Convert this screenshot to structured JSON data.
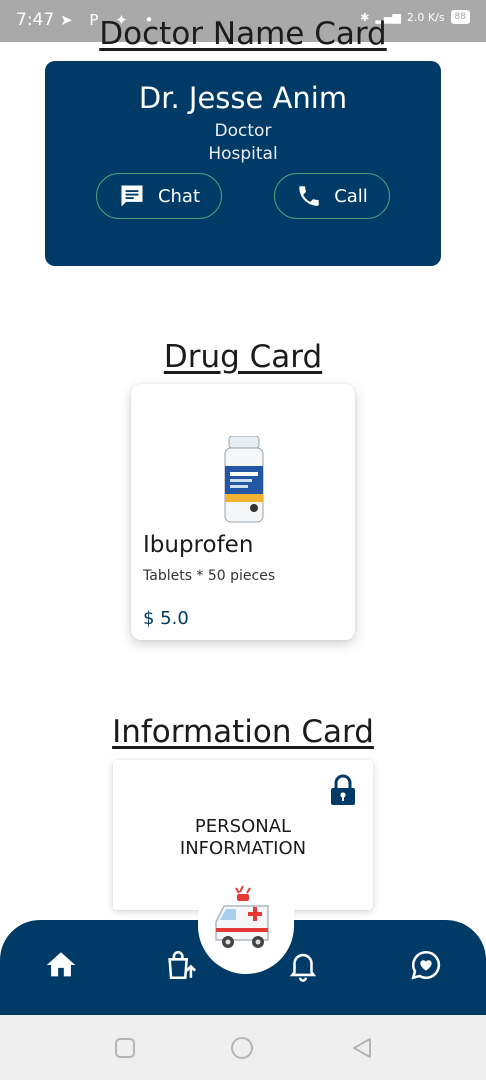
{
  "status_bar": {
    "time": "7:47",
    "notification_icons": [
      "telegram-icon",
      "p-icon",
      "twitter-icon",
      "dot-icon"
    ],
    "network_speed": "2.0 K/s",
    "battery": "88"
  },
  "doctor_section": {
    "title": "Doctor Name Card",
    "name": "Dr. Jesse Anim",
    "role": "Doctor",
    "workplace": "Hospital",
    "chat_label": "Chat",
    "call_label": "Call"
  },
  "drug_section": {
    "title": "Drug Card",
    "drug_name": "Ibuprofen",
    "description": "Tablets * 50 pieces",
    "price": "$ 5.0"
  },
  "info_section": {
    "title": "Information Card",
    "line1": "PERSONAL",
    "line2": "INFORMATION"
  },
  "bottom_nav": {
    "items": [
      "home-icon",
      "shopping-bag-upload-icon",
      "ambulance-icon",
      "bell-icon",
      "chat-heart-icon"
    ],
    "accent": "#003a66"
  },
  "colors": {
    "primary": "#003a66",
    "pill_border": "#48a27a",
    "status_bar": "#a9a9a9"
  }
}
